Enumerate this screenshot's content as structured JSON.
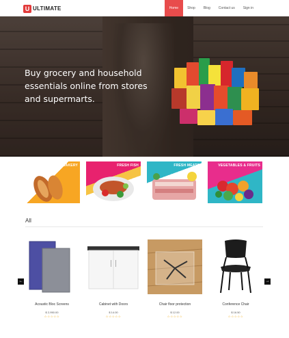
{
  "brand": {
    "logo_letter": "U",
    "name": "ULTIMATE"
  },
  "nav": [
    {
      "label": "Home",
      "active": true
    },
    {
      "label": "Shop",
      "active": false
    },
    {
      "label": "Blog",
      "active": false
    },
    {
      "label": "Contact us",
      "active": false
    },
    {
      "label": "Sign in",
      "active": false
    }
  ],
  "hero": {
    "headline": "Buy grocery and household essentials online from stores and supermarts."
  },
  "categories": [
    {
      "label": "BREAD & BAKERY",
      "color": "#f7a623"
    },
    {
      "label": "FRESH FISH",
      "color": "#e8226e"
    },
    {
      "label": "FRESH MEATS",
      "color": "#2fb6c6"
    },
    {
      "label": "VEGETABLES & FRUITS",
      "color": "#e82d8c"
    }
  ],
  "section": {
    "title": "All"
  },
  "carousel": {
    "prev_icon": "arrow-left-icon",
    "next_icon": "arrow-right-icon",
    "prev_glyph": "←",
    "next_glyph": "→"
  },
  "products": [
    {
      "name": "Acoustic Bloc Screens",
      "price": "$ 2,950.00",
      "rating": "☆☆☆☆☆"
    },
    {
      "name": "Cabinet with Doors",
      "price": "$ 14.00",
      "rating": "☆☆☆☆☆"
    },
    {
      "name": "Chair floor protection",
      "price": "$ 12.00",
      "rating": "☆☆☆☆☆"
    },
    {
      "name": "Conference Chair",
      "price": "$ 16.50",
      "rating": "☆☆☆☆☆"
    }
  ]
}
